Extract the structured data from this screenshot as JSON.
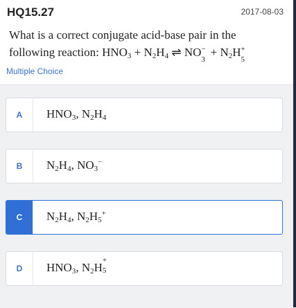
{
  "header": {
    "question_id": "HQ15.27",
    "date": "2017-08-03",
    "question_prefix": "What is a correct conjugate acid-base pair in the following reaction: ",
    "question_type": "Multiple Choice"
  },
  "equation": {
    "hno3_main": "HNO",
    "hno3_sub": "3",
    "plus1": " + N",
    "n2h4_sub1": "2",
    "n2h4_mid": "H",
    "n2h4_sub2": "4",
    "arrow": " ⇌ ",
    "no3_main": "NO",
    "no3_sup": "−",
    "no3_sub": "3",
    "plus2": " + N",
    "n2h5_sub1": "2",
    "n2h5_mid": "H",
    "n2h5_sup": "+",
    "n2h5_sub2": "5"
  },
  "options": [
    {
      "letter": "A",
      "selected": false,
      "a1": "HNO",
      "a2": "3",
      "a3": ", N",
      "a4": "2",
      "a5": "H",
      "a6": "4"
    },
    {
      "letter": "B",
      "selected": false,
      "a1": "N",
      "a2": "2",
      "a3": "H",
      "a4": "4",
      "a5": ", NO",
      "a6": "3",
      "a7": "−"
    },
    {
      "letter": "C",
      "selected": true,
      "a1": "N",
      "a2": "2",
      "a3": "H",
      "a4": "4",
      "a5": ", N",
      "a6": "2",
      "a7": "H",
      "a8": "5",
      "a9": "+"
    },
    {
      "letter": "D",
      "selected": false,
      "a1": "HNO",
      "a2": "3",
      "a3": ", N",
      "a4": "2",
      "a5": "H",
      "a6": "+",
      "a7": "5"
    }
  ],
  "colors": {
    "accent": "#2f6fd6",
    "label_blue": "#3b73c8",
    "background": "#f0f1f3"
  }
}
